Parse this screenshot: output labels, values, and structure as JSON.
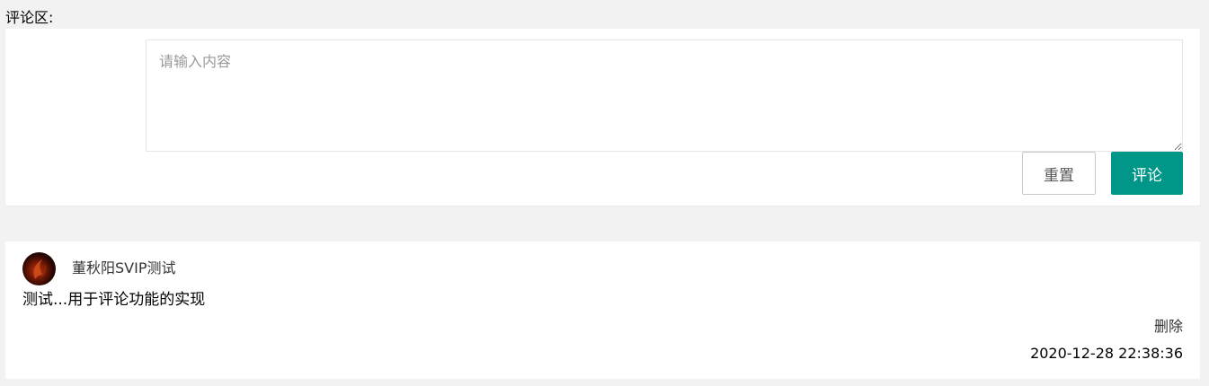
{
  "section": {
    "label": "评论区:"
  },
  "form": {
    "placeholder": "请输入内容",
    "value": "",
    "reset_label": "重置",
    "submit_label": "评论",
    "submit_color": "#009688"
  },
  "comments": [
    {
      "avatar_icon": "user-avatar",
      "username": "董秋阳SVIP测试",
      "text": "测试...用于评论功能的实现",
      "delete_label": "删除",
      "timestamp": "2020-12-28 22:38:36"
    }
  ]
}
